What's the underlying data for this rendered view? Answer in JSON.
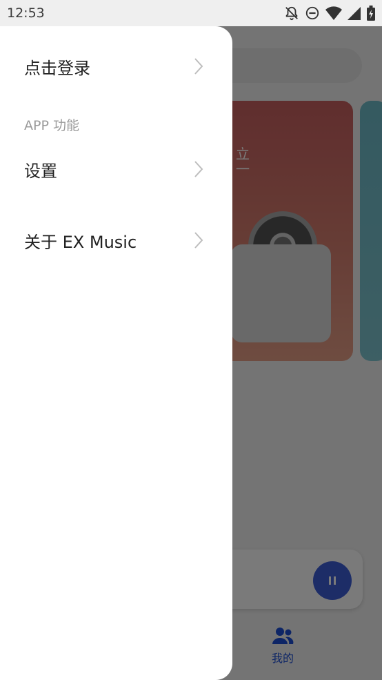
{
  "status_bar": {
    "time": "12:53",
    "icons": [
      "notifications-off-icon",
      "do-not-disturb-icon",
      "wifi-icon",
      "signal-icon",
      "battery-charging-icon"
    ]
  },
  "drawer": {
    "login": {
      "label": "点击登录"
    },
    "section_title": "APP 功能",
    "items": [
      {
        "label": "设置"
      },
      {
        "label": "关于 EX Music"
      }
    ]
  },
  "background": {
    "card_text": "立\n一",
    "nav_item_label": "我的"
  },
  "colors": {
    "accent": "#3d5ed8",
    "nav_active": "#1d4fd6",
    "scrim": "rgba(0,0,0,0.52)"
  }
}
